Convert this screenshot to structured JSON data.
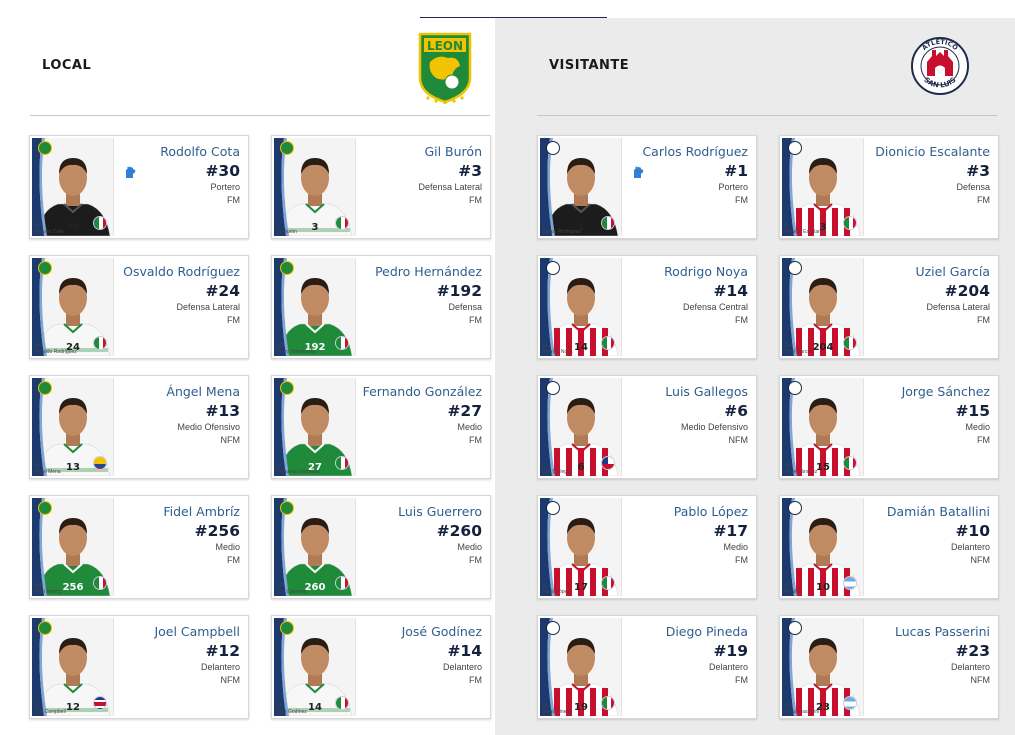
{
  "colors": {
    "accent": "#2f5e8f",
    "number": "#14213d",
    "leon_green": "#1f8a3a",
    "sanluis_red": "#c8102e"
  },
  "local": {
    "label": "LOCAL",
    "logo": "club-leon-crest",
    "logo_text": "LEON",
    "players": [
      {
        "name": "Rodolfo Cota",
        "number": "#30",
        "position": "Portero",
        "status": "FM",
        "caption": "Rodolfo Cota",
        "shirt": "30",
        "goalkeeper": true,
        "kit": "gk",
        "flag": "mexico"
      },
      {
        "name": "Gil Burón",
        "number": "#3",
        "position": "Defensa Lateral",
        "status": "FM",
        "caption": "Gil Burón",
        "shirt": "3",
        "goalkeeper": false,
        "kit": "white",
        "flag": "mexico"
      },
      {
        "name": "Osvaldo Rodríguez",
        "number": "#24",
        "position": "Defensa Lateral",
        "status": "FM",
        "caption": "Osvaldo Rodríguez",
        "shirt": "24",
        "goalkeeper": false,
        "kit": "white",
        "flag": "mexico"
      },
      {
        "name": "Pedro Hernández",
        "number": "#192",
        "position": "Defensa",
        "status": "FM",
        "caption": "Pedro Hernández",
        "shirt": "192",
        "goalkeeper": false,
        "kit": "green",
        "flag": "mexico"
      },
      {
        "name": "Ángel Mena",
        "number": "#13",
        "position": "Medio Ofensivo",
        "status": "NFM",
        "caption": "Ángel Mena",
        "shirt": "13",
        "goalkeeper": false,
        "kit": "white",
        "flag": "ecuador"
      },
      {
        "name": "Fernando González",
        "number": "#27",
        "position": "Medio",
        "status": "FM",
        "caption": "Fernando González",
        "shirt": "27",
        "goalkeeper": false,
        "kit": "green",
        "flag": "mexico"
      },
      {
        "name": "Fidel Ambríz",
        "number": "#256",
        "position": "Medio",
        "status": "FM",
        "caption": "Fidel Ambriz",
        "shirt": "256",
        "goalkeeper": false,
        "kit": "green",
        "flag": "mexico"
      },
      {
        "name": "Luis Guerrero",
        "number": "#260",
        "position": "Medio",
        "status": "FM",
        "caption": "Luis Guerrero",
        "shirt": "260",
        "goalkeeper": false,
        "kit": "green",
        "flag": "mexico"
      },
      {
        "name": "Joel Campbell",
        "number": "#12",
        "position": "Delantero",
        "status": "NFM",
        "caption": "Joel Campbell",
        "shirt": "12",
        "goalkeeper": false,
        "kit": "white",
        "flag": "costarica"
      },
      {
        "name": "José Godínez",
        "number": "#14",
        "position": "Delantero",
        "status": "FM",
        "caption": "José Godínez",
        "shirt": "14",
        "goalkeeper": false,
        "kit": "white",
        "flag": "mexico"
      }
    ]
  },
  "visitante": {
    "label": "VISITANTE",
    "logo": "atletico-san-luis-crest",
    "logo_top": "ATLÉTICO",
    "logo_bottom": "SAN LUIS",
    "players": [
      {
        "name": "Carlos Rodríguez",
        "number": "#1",
        "position": "Portero",
        "status": "FM",
        "caption": "Carlos Rodríguez",
        "shirt": "1",
        "goalkeeper": true,
        "kit": "gk",
        "flag": "mexico"
      },
      {
        "name": "Dionicio Escalante",
        "number": "#3",
        "position": "Defensa",
        "status": "FM",
        "caption": "Dionicio Escalante",
        "shirt": "3",
        "goalkeeper": false,
        "kit": "stripes",
        "flag": "mexico"
      },
      {
        "name": "Rodrigo Noya",
        "number": "#14",
        "position": "Defensa Central",
        "status": "FM",
        "caption": "Rodrigo Noya",
        "shirt": "14",
        "goalkeeper": false,
        "kit": "stripes",
        "flag": "mexico"
      },
      {
        "name": "Uziel García",
        "number": "#204",
        "position": "Defensa Lateral",
        "status": "FM",
        "caption": "Uziel García",
        "shirt": "204",
        "goalkeeper": false,
        "kit": "stripes",
        "flag": "mexico"
      },
      {
        "name": "Luis Gallegos",
        "number": "#6",
        "position": "Medio Defensivo",
        "status": "NFM",
        "caption": "Luis Gallegos",
        "shirt": "6",
        "goalkeeper": false,
        "kit": "stripes",
        "flag": "chile"
      },
      {
        "name": "Jorge Sánchez",
        "number": "#15",
        "position": "Medio",
        "status": "FM",
        "caption": "Jorge Sánchez",
        "shirt": "15",
        "goalkeeper": false,
        "kit": "stripes",
        "flag": "mexico"
      },
      {
        "name": "Pablo López",
        "number": "#17",
        "position": "Medio",
        "status": "FM",
        "caption": "Pablo López",
        "shirt": "17",
        "goalkeeper": false,
        "kit": "stripes",
        "flag": "mexico"
      },
      {
        "name": "Damián Batallini",
        "number": "#10",
        "position": "Delantero",
        "status": "NFM",
        "caption": "Batallini",
        "shirt": "10",
        "goalkeeper": false,
        "kit": "stripes",
        "flag": "argentina"
      },
      {
        "name": "Diego Pineda",
        "number": "#19",
        "position": "Delantero",
        "status": "FM",
        "caption": "Diego Pineda",
        "shirt": "19",
        "goalkeeper": false,
        "kit": "stripes",
        "flag": "mexico"
      },
      {
        "name": "Lucas Passerini",
        "number": "#23",
        "position": "Delantero",
        "status": "NFM",
        "caption": "Lucas Passerini",
        "shirt": "23",
        "goalkeeper": false,
        "kit": "stripes",
        "flag": "argentina"
      }
    ]
  }
}
